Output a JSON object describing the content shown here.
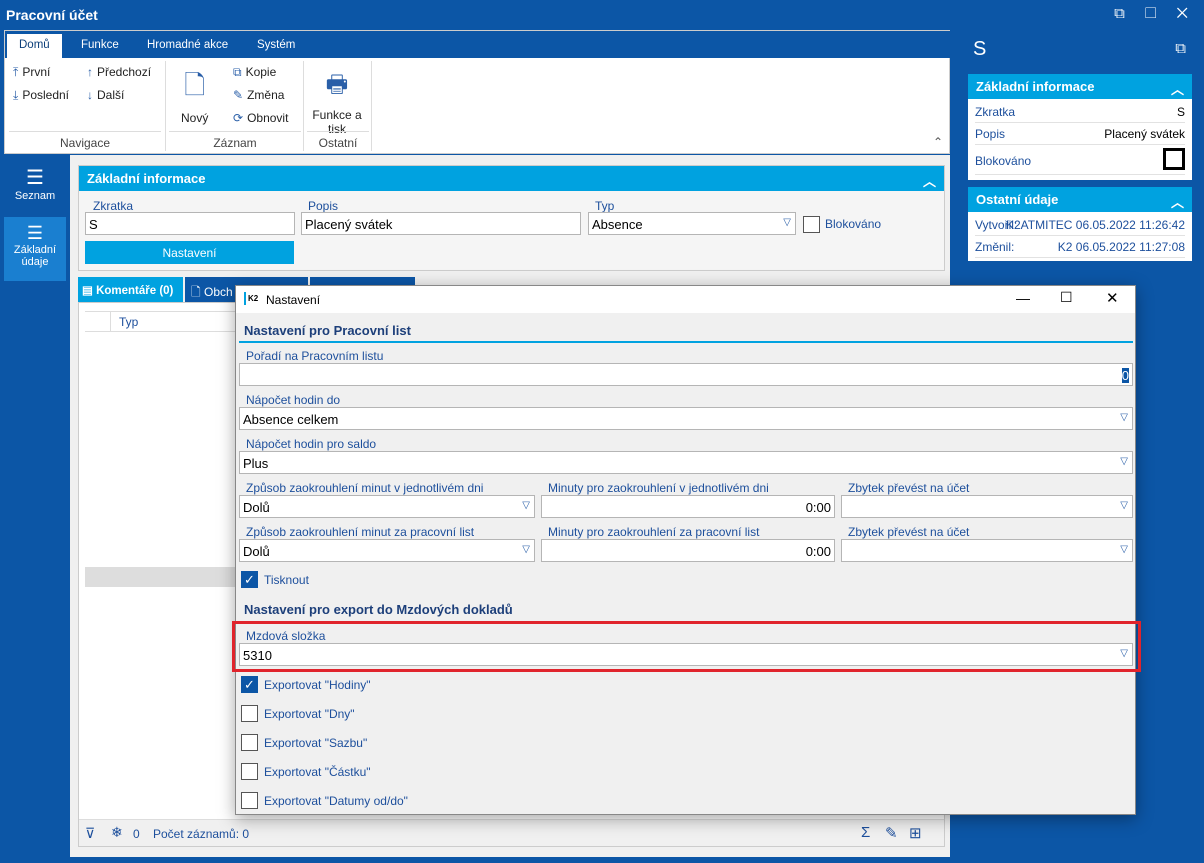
{
  "window": {
    "title": "Pracovní účet",
    "controls": "⧉ ☐ ✕"
  },
  "ribbon": {
    "tabs": [
      "Domů",
      "Funkce",
      "Hromadné akce",
      "Systém"
    ],
    "navigace": {
      "first": "První",
      "prev": "Předchozí",
      "last": "Poslední",
      "next": "Další",
      "group": "Navigace"
    },
    "zaznam": {
      "new": "Nový",
      "copy": "Kopie",
      "edit": "Změna",
      "refresh": "Obnovit",
      "group": "Záznam"
    },
    "ostatni": {
      "print": "Funkce a tisk",
      "group": "Ostatní"
    }
  },
  "leftnav": {
    "items": [
      {
        "label": "Seznam"
      },
      {
        "label": "Základní údaje"
      }
    ]
  },
  "basic": {
    "header": "Základní informace",
    "zkratka_label": "Zkratka",
    "zkratka": "S",
    "popis_label": "Popis",
    "popis": "Placený svátek",
    "typ_label": "Typ",
    "typ": "Absence",
    "blokovano": "Blokováno",
    "nastaveni": "Nastavení"
  },
  "tabs": {
    "komentare": "Komentáře (0)",
    "obch": "Obch"
  },
  "grid": {
    "col_typ": "Typ"
  },
  "footer": {
    "freeze_count": "0",
    "count": "Počet záznamů: 0"
  },
  "right": {
    "title": "S",
    "basic": {
      "header": "Základní informace",
      "rows": [
        {
          "k": "Zkratka",
          "v": "S"
        },
        {
          "k": "Popis",
          "v": "Placený svátek"
        },
        {
          "k": "Blokováno",
          "v": ""
        }
      ]
    },
    "other": {
      "header": "Ostatní údaje",
      "rows": [
        {
          "k": "Vytvořil:",
          "v": "K2ATMITEC 06.05.2022 11:26:42"
        },
        {
          "k": "Změnil:",
          "v": "K2 06.05.2022 11:27:08"
        }
      ]
    }
  },
  "dialog": {
    "title": "Nastavení",
    "logo": "K2",
    "section1": "Nastavení pro Pracovní list",
    "poradi_label": "Pořadí na Pracovním listu",
    "poradi": "0",
    "napocet_label": "Nápočet hodin do",
    "napocet": "Absence celkem",
    "saldo_label": "Nápočet hodin pro saldo",
    "saldo": "Plus",
    "row1": {
      "a_label": "Způsob zaokrouhlení minut v jednotlivém dni",
      "a": "Dolů",
      "b_label": "Minuty pro zaokrouhlení v jednotlivém dni",
      "b": "0:00",
      "c_label": "Zbytek převést na účet",
      "c": ""
    },
    "row2": {
      "a_label": "Způsob zaokrouhlení minut za pracovní list",
      "a": "Dolů",
      "b_label": "Minuty pro zaokrouhlení za pracovní list",
      "b": "0:00",
      "c_label": "Zbytek převést na účet",
      "c": ""
    },
    "tisknout": "Tisknout",
    "section2": "Nastavení pro export do Mzdových dokladů",
    "mzdova_label": "Mzdová složka",
    "mzdova": "5310",
    "exports": [
      {
        "label": "Exportovat \"Hodiny\"",
        "checked": true
      },
      {
        "label": "Exportovat \"Dny\"",
        "checked": false
      },
      {
        "label": "Exportovat \"Sazbu\"",
        "checked": false
      },
      {
        "label": "Exportovat \"Částku\"",
        "checked": false
      },
      {
        "label": "Exportovat \"Datumy od/do\"",
        "checked": false
      }
    ]
  },
  "colors": {
    "brand": "#0c56a6",
    "accent": "#00a2e0",
    "highlight": "#e0242c"
  }
}
